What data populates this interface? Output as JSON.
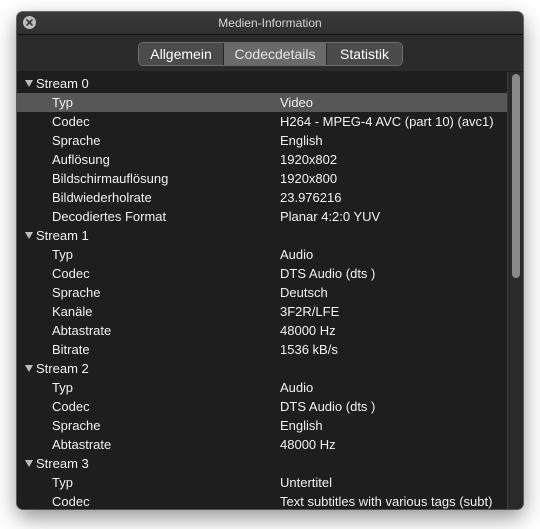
{
  "window": {
    "title": "Medien-Information"
  },
  "tabs": [
    {
      "label": "Allgemein"
    },
    {
      "label": "Codecdetails"
    },
    {
      "label": "Statistik"
    }
  ],
  "active_tab_index": 1,
  "streams": [
    {
      "name": "Stream 0",
      "properties": [
        {
          "key": "Typ",
          "value": "Video"
        },
        {
          "key": "Codec",
          "value": "H264 - MPEG-4 AVC (part 10) (avc1)"
        },
        {
          "key": "Sprache",
          "value": "English"
        },
        {
          "key": "Auflösung",
          "value": "1920x802"
        },
        {
          "key": "Bildschirmauflösung",
          "value": "1920x800"
        },
        {
          "key": "Bildwiederholrate",
          "value": "23.976216"
        },
        {
          "key": "Decodiertes Format",
          "value": "Planar 4:2:0 YUV"
        }
      ]
    },
    {
      "name": "Stream 1",
      "properties": [
        {
          "key": "Typ",
          "value": "Audio"
        },
        {
          "key": "Codec",
          "value": "DTS Audio (dts )"
        },
        {
          "key": "Sprache",
          "value": "Deutsch"
        },
        {
          "key": "Kanäle",
          "value": "3F2R/LFE"
        },
        {
          "key": "Abtastrate",
          "value": "48000 Hz"
        },
        {
          "key": "Bitrate",
          "value": "1536 kB/s"
        }
      ]
    },
    {
      "name": "Stream 2",
      "properties": [
        {
          "key": "Typ",
          "value": "Audio"
        },
        {
          "key": "Codec",
          "value": "DTS Audio (dts )"
        },
        {
          "key": "Sprache",
          "value": "English"
        },
        {
          "key": "Abtastrate",
          "value": "48000 Hz"
        }
      ]
    },
    {
      "name": "Stream 3",
      "properties": [
        {
          "key": "Typ",
          "value": "Untertitel"
        },
        {
          "key": "Codec",
          "value": "Text subtitles with various tags (subt)"
        }
      ]
    }
  ],
  "selected_row": {
    "stream": 0,
    "property": 0
  },
  "colors": {
    "background": "#1e1e1e",
    "selection": "#575757",
    "text": "#f2f2f2"
  }
}
